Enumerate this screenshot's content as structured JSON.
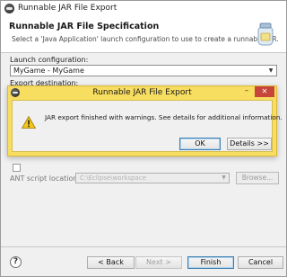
{
  "window": {
    "title": "Runnable JAR File Export"
  },
  "header": {
    "title": "Runnable JAR File Specification",
    "description": "Select a 'Java Application' launch configuration to use to create a runnable JAR."
  },
  "launch_configuration": {
    "label": "Launch configuration:",
    "value": "MyGame - MyGame"
  },
  "export_destination": {
    "label": "Export destination:"
  },
  "ant_script": {
    "label": "ANT script location:",
    "value": "C:\\Eclipse\\workspace",
    "browse_label": "Browse..."
  },
  "footer": {
    "help_glyph": "?",
    "back_label": "< Back",
    "next_label": "Next >",
    "finish_label": "Finish",
    "cancel_label": "Cancel"
  },
  "dialog": {
    "title": "Runnable JAR File Export",
    "message": "JAR export finished with warnings. See details for additional information.",
    "ok_label": "OK",
    "details_label": "Details >>",
    "minimize_glyph": "–",
    "close_glyph": "✕",
    "icon": "warning-icon"
  },
  "colors": {
    "dialog_frame": "#f7dd60",
    "close_button": "#c7463a",
    "default_button_border": "#3c7fb1"
  }
}
